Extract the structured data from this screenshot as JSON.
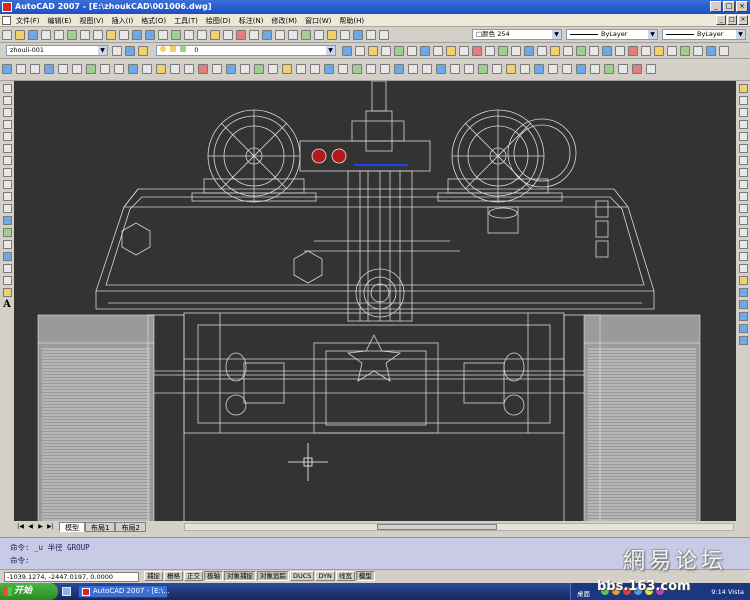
{
  "window": {
    "title": "AutoCAD 2007 - [E:\\zhoukCAD\\001006.dwg]",
    "controls": [
      "_",
      "□",
      "×"
    ]
  },
  "menu": {
    "items": [
      "文件(F)",
      "编辑(E)",
      "视图(V)",
      "插入(I)",
      "格式(O)",
      "工具(T)",
      "绘图(D)",
      "标注(N)",
      "修改(M)",
      "窗口(W)",
      "帮助(H)"
    ]
  },
  "properties_toolbar": {
    "color_value": "□颜色 254",
    "linetype_value": "ByLayer",
    "lineweight_value": "ByLayer"
  },
  "layers_toolbar": {
    "workspace_value": "zhouli-001",
    "layer_value": "0"
  },
  "layout_tabs": {
    "nav": [
      "|◀",
      "◀",
      "▶",
      "▶|"
    ],
    "tabs": [
      "模型",
      "布局1",
      "布局2"
    ],
    "active": "模型"
  },
  "command": {
    "history_line": "命令: _u 半径 GROUP",
    "prompt": "命令:"
  },
  "status": {
    "coordinates": "-1039.1274, -2447.0197, 0.0000",
    "modes": [
      {
        "label": "捕捉",
        "on": false
      },
      {
        "label": "栅格",
        "on": false
      },
      {
        "label": "正交",
        "on": false
      },
      {
        "label": "极轴",
        "on": true
      },
      {
        "label": "对象捕捉",
        "on": true
      },
      {
        "label": "对象追踪",
        "on": true
      },
      {
        "label": "DUCS",
        "on": false
      },
      {
        "label": "DYN",
        "on": false
      },
      {
        "label": "线宽",
        "on": false
      },
      {
        "label": "模型",
        "on": true
      }
    ]
  },
  "taskbar": {
    "start_label": "开始",
    "task_button": "AutoCAD 2007 - [E:\\...",
    "tray_label": "桌面",
    "clock": "9:14 Vista"
  },
  "watermark": {
    "main": "網易论坛",
    "sub": "bbs.163.com"
  },
  "colors": {
    "canvas": "#333333",
    "wireframe": "#d8d8d8",
    "title_bar": "#1b4fc6",
    "command_area": "#c9cbe6"
  }
}
